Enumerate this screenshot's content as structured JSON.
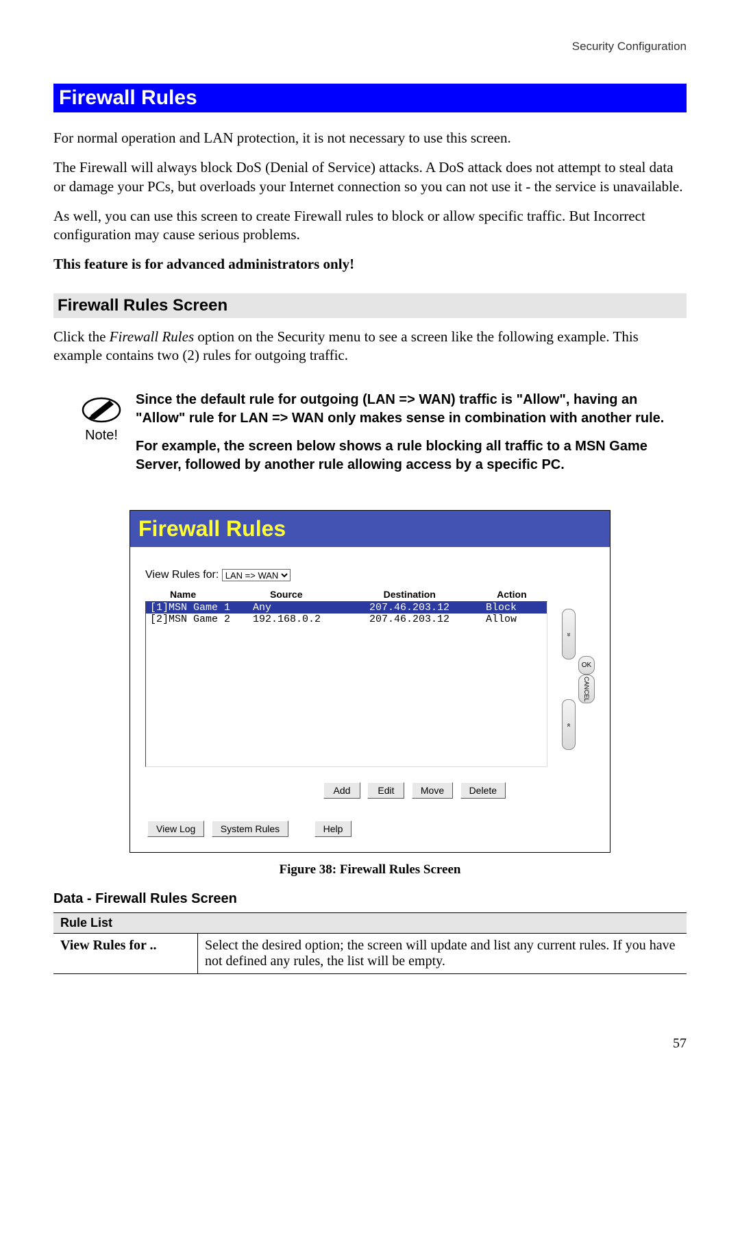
{
  "header": {
    "section": "Security Configuration"
  },
  "title": "Firewall Rules",
  "paragraphs": {
    "p1": "For normal operation and LAN protection, it is not necessary to use this screen.",
    "p2": "The Firewall will always block DoS (Denial of Service) attacks. A DoS attack does not attempt to steal data or damage your PCs, but overloads your Internet connection so you can not use it - the service is unavailable.",
    "p3": "As well, you can use this screen to create Firewall rules to block or allow specific traffic. But Incorrect configuration may cause serious problems.",
    "p4": "This feature is for advanced administrators only!"
  },
  "section2": {
    "heading": "Firewall Rules Screen",
    "intro_pre": "Click the ",
    "intro_em": "Firewall Rules",
    "intro_post": " option on the Security menu to see a screen like the following example. This example contains two (2) rules for outgoing traffic."
  },
  "note": {
    "label": "Note!",
    "p1": "Since the default rule for outgoing (LAN => WAN) traffic is \"Allow\", having an \"Allow\" rule for LAN => WAN only makes sense in combination with another rule.",
    "p2": "For example, the screen below shows a rule blocking all traffic to a MSN Game Server, followed by another rule allowing access by a specific PC."
  },
  "screenshot": {
    "title": "Firewall Rules",
    "view_rules_label": "View Rules for:",
    "view_rules_selected": "LAN => WAN",
    "columns": {
      "name": "Name",
      "source": "Source",
      "destination": "Destination",
      "action": "Action"
    },
    "rows": [
      {
        "name": "[1]MSN Game 1",
        "source": "Any",
        "dest": "207.46.203.12",
        "action": "Block",
        "selected": true
      },
      {
        "name": "[2]MSN Game 2",
        "source": "192.168.0.2",
        "dest": "207.46.203.12",
        "action": "Allow",
        "selected": false
      }
    ],
    "side_buttons": {
      "up": "»",
      "ok": "OK",
      "cancel": "CANCEL",
      "down": "«"
    },
    "buttons_row1": {
      "add": "Add",
      "edit": "Edit",
      "move": "Move",
      "delete": "Delete"
    },
    "buttons_row2": {
      "viewlog": "View Log",
      "sysrules": "System Rules",
      "help": "Help"
    }
  },
  "figure_caption": "Figure 38: Firewall Rules Screen",
  "data_section": {
    "heading": "Data - Firewall Rules Screen",
    "table_header": "Rule List",
    "row_label": "View Rules for ..",
    "row_text": "Select the desired option; the screen will update and list any current rules. If you have not defined any rules, the list will be empty."
  },
  "page_number": "57"
}
